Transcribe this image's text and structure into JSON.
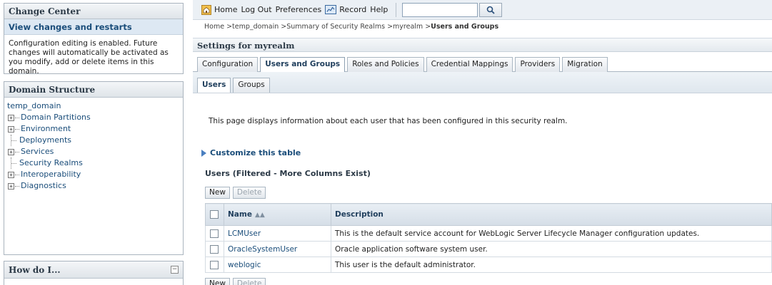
{
  "change_center": {
    "title": "Change Center",
    "link": "View changes and restarts",
    "message": "Configuration editing is enabled. Future changes will automatically be activated as you modify, add or delete items in this domain."
  },
  "domain_structure": {
    "title": "Domain Structure",
    "root": "temp_domain",
    "items": [
      {
        "label": "Domain Partitions",
        "expandable": true
      },
      {
        "label": "Environment",
        "expandable": true
      },
      {
        "label": "Deployments",
        "expandable": false
      },
      {
        "label": "Services",
        "expandable": true
      },
      {
        "label": "Security Realms",
        "expandable": false
      },
      {
        "label": "Interoperability",
        "expandable": true
      },
      {
        "label": "Diagnostics",
        "expandable": true
      }
    ]
  },
  "how_do_i": {
    "title": "How do I..."
  },
  "topbar": {
    "home": "Home",
    "logout": "Log Out",
    "preferences": "Preferences",
    "record": "Record",
    "help": "Help",
    "search_value": ""
  },
  "breadcrumb": {
    "items": [
      "Home",
      "temp_domain",
      "Summary of Security Realms",
      "myrealm"
    ],
    "current": "Users and Groups"
  },
  "settings": {
    "title": "Settings for myrealm",
    "tabs": [
      "Configuration",
      "Users and Groups",
      "Roles and Policies",
      "Credential Mappings",
      "Providers",
      "Migration"
    ],
    "active_tab": 1,
    "subtabs": [
      "Users",
      "Groups"
    ],
    "active_subtab": 0
  },
  "main": {
    "description": "This page displays information about each user that has been configured in this security realm.",
    "customize": "Customize this table",
    "table_caption": "Users (Filtered - More Columns Exist)",
    "buttons": {
      "new": "New",
      "delete": "Delete"
    },
    "columns": {
      "name": "Name",
      "description": "Description"
    },
    "rows": [
      {
        "name": "LCMUser",
        "description": "This is the default service account for WebLogic Server Lifecycle Manager configuration updates."
      },
      {
        "name": "OracleSystemUser",
        "description": "Oracle application software system user."
      },
      {
        "name": "weblogic",
        "description": "This user is the default administrator."
      }
    ]
  }
}
